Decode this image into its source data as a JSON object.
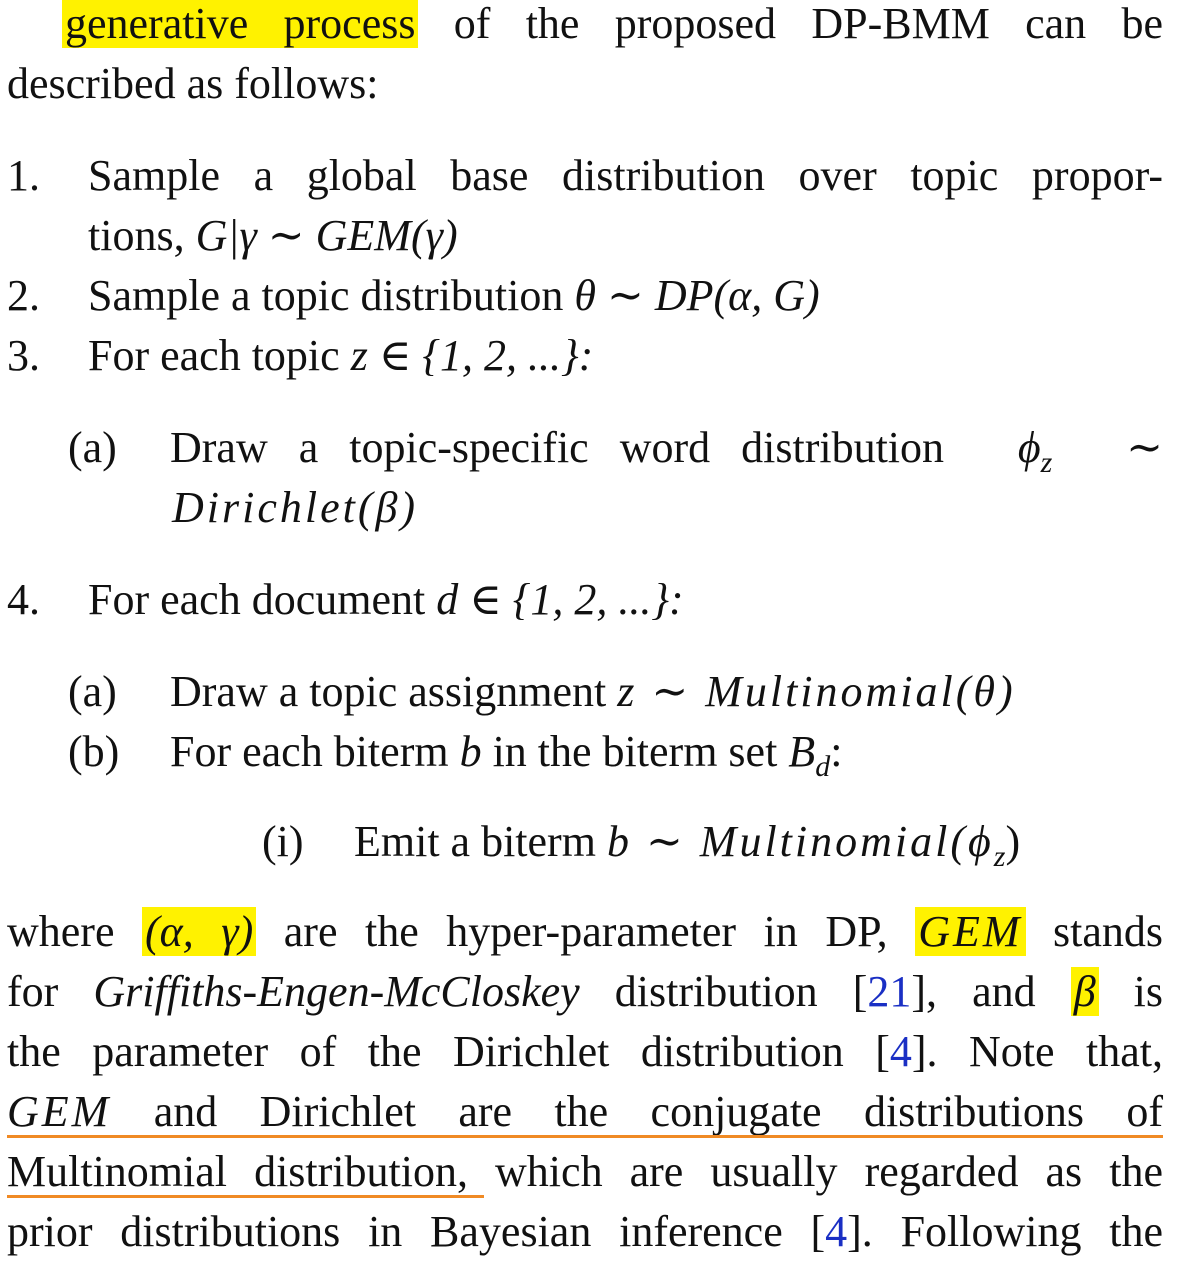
{
  "intro": {
    "l1_hl": "generative process",
    "l1_rest": "of the proposed DP-BMM can be",
    "l2": "described as follows:"
  },
  "steps": {
    "s1_num": "1.",
    "s1_l1": "Sample a global base distribution over topic propor-",
    "s1_l2_text": "tions,",
    "s1_l2_math": "G|γ ∼ GEM(γ)",
    "s2_num": "2.",
    "s2_text": "Sample a topic distribution",
    "s2_math": "θ ∼ DP(α, G)",
    "s3_num": "3.",
    "s3_text": "For each topic",
    "s3_math": "z ∈ {1, 2, ...}:",
    "s3a_label": "(a)",
    "s3a_l1": "Draw a topic-specific word distribution",
    "s3a_phi": "ϕ",
    "s3a_sub": "z",
    "s3a_tilde": "∼",
    "s3a_l2": "Dirichlet(β)",
    "s4_num": "4.",
    "s4_text": "For each document",
    "s4_math": "d ∈ {1, 2, ...}:",
    "s4a_label": "(a)",
    "s4a_text": "Draw a topic assignment",
    "s4a_math": "z ∼ Multinomial(θ)",
    "s4b_label": "(b)",
    "s4b_text": "For each biterm",
    "s4b_b": "b",
    "s4b_text2": "in the biterm set",
    "s4b_B": "B",
    "s4b_sub": "d",
    "s4b_colon": ":",
    "s4bi_label": "(i)",
    "s4bi_text": "Emit a biterm",
    "s4bi_math": "b ∼ Multinomial(ϕ",
    "s4bi_sub": "z",
    "s4bi_close": ")"
  },
  "para": {
    "l1_a": "where",
    "l1_hl1": "(α, γ)",
    "l1_b": "are the hyper-parameter in DP,",
    "l1_hl2": "GEM",
    "l1_c": "stands",
    "l2_a": "for",
    "l2_it": "Griffiths-Engen-McCloskey",
    "l2_b": "distribution [",
    "l2_cite": "21",
    "l2_c": "], and",
    "l2_hl": "β",
    "l2_d": "is",
    "l3_a": "the parameter of the Dirichlet distribution [",
    "l3_cite": "4",
    "l3_b": "]. Note that,",
    "l4_it": "GEM",
    "l4_b": "and Dirichlet are the conjugate distributions of",
    "l5_a": "Multinomial distribution",
    "l5_b": ", which are usually regarded as the",
    "l6_a": "prior distributions in Bayesian inference [",
    "l6_cite": "4",
    "l6_b": "]. Following the"
  },
  "colors": {
    "highlight": "#fff200",
    "underline": "#f08a24",
    "citation": "#1a2fc4"
  }
}
